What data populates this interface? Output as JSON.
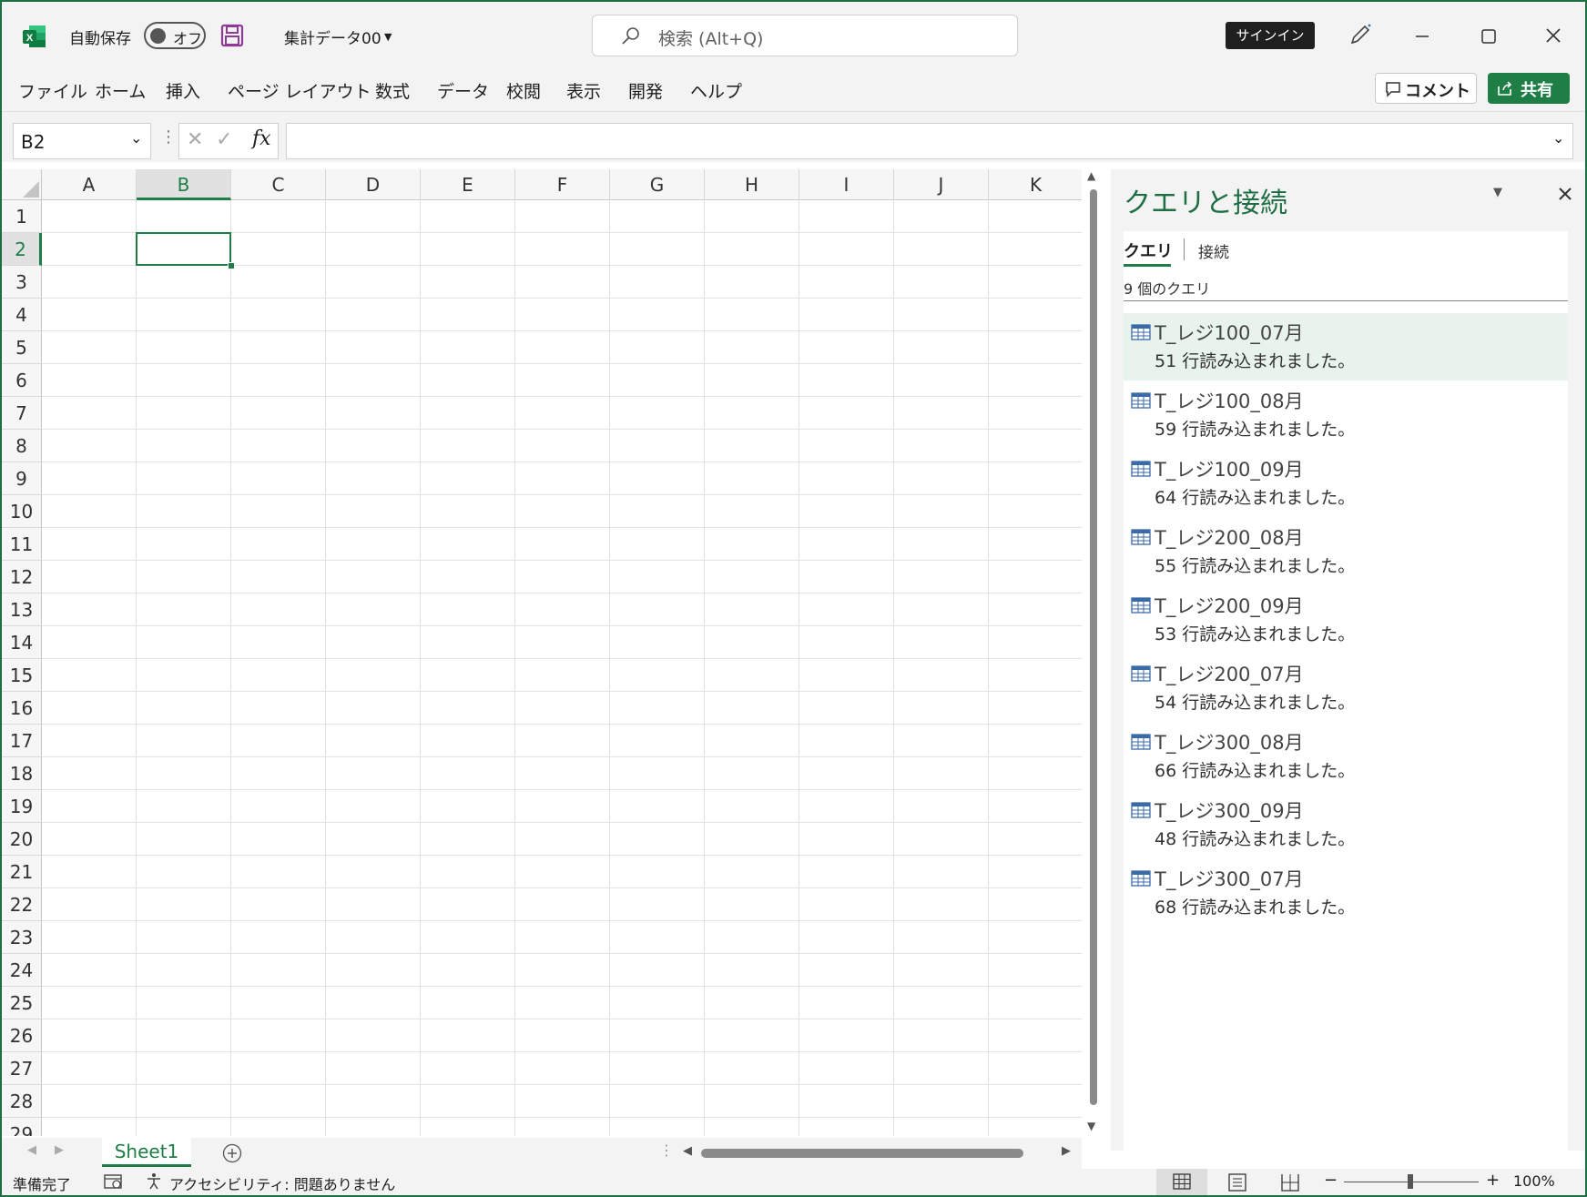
{
  "titlebar": {
    "autosave_label": "自動保存",
    "autosave_state": "オフ",
    "filename": "集計データ00",
    "search_placeholder": "検索 (Alt+Q)",
    "signin_label": "サインイン"
  },
  "menu": {
    "items": [
      "ファイル",
      "ホーム",
      "挿入",
      "ページ レイアウト",
      "数式",
      "データ",
      "校閲",
      "表示",
      "開発",
      "ヘルプ"
    ],
    "comment_label": "コメント",
    "share_label": "共有"
  },
  "formula": {
    "name_box": "B2",
    "fx_label": "fx",
    "value": ""
  },
  "grid": {
    "columns": [
      "A",
      "B",
      "C",
      "D",
      "E",
      "F",
      "G",
      "H",
      "I",
      "J",
      "K"
    ],
    "rows": [
      "1",
      "2",
      "3",
      "4",
      "5",
      "6",
      "7",
      "8",
      "9",
      "10",
      "11",
      "12",
      "13",
      "14",
      "15",
      "16",
      "17",
      "18",
      "19",
      "20",
      "21",
      "22",
      "23",
      "24",
      "25",
      "26",
      "27",
      "28",
      "29"
    ],
    "selected_column": "B",
    "selected_row": "2"
  },
  "sheets": {
    "tabs": [
      "Sheet1"
    ],
    "active": "Sheet1"
  },
  "panel": {
    "title": "クエリと接続",
    "tab_queries": "クエリ",
    "tab_connections": "接続",
    "count_label": "9 個のクエリ",
    "queries": [
      {
        "name": "T_レジ100_07月",
        "status": "51 行読み込まれました。"
      },
      {
        "name": "T_レジ100_08月",
        "status": "59 行読み込まれました。"
      },
      {
        "name": "T_レジ100_09月",
        "status": "64 行読み込まれました。"
      },
      {
        "name": "T_レジ200_08月",
        "status": "55 行読み込まれました。"
      },
      {
        "name": "T_レジ200_09月",
        "status": "53 行読み込まれました。"
      },
      {
        "name": "T_レジ200_07月",
        "status": "54 行読み込まれました。"
      },
      {
        "name": "T_レジ300_08月",
        "status": "66 行読み込まれました。"
      },
      {
        "name": "T_レジ300_09月",
        "status": "48 行読み込まれました。"
      },
      {
        "name": "T_レジ300_07月",
        "status": "68 行読み込まれました。"
      }
    ]
  },
  "status": {
    "ready": "準備完了",
    "accessibility": "アクセシビリティ: 問題ありません",
    "zoom": "100%"
  },
  "colors": {
    "accent": "#1e7e45",
    "title_green": "#1e6e44",
    "selection_fill": "#e8f3ec"
  }
}
